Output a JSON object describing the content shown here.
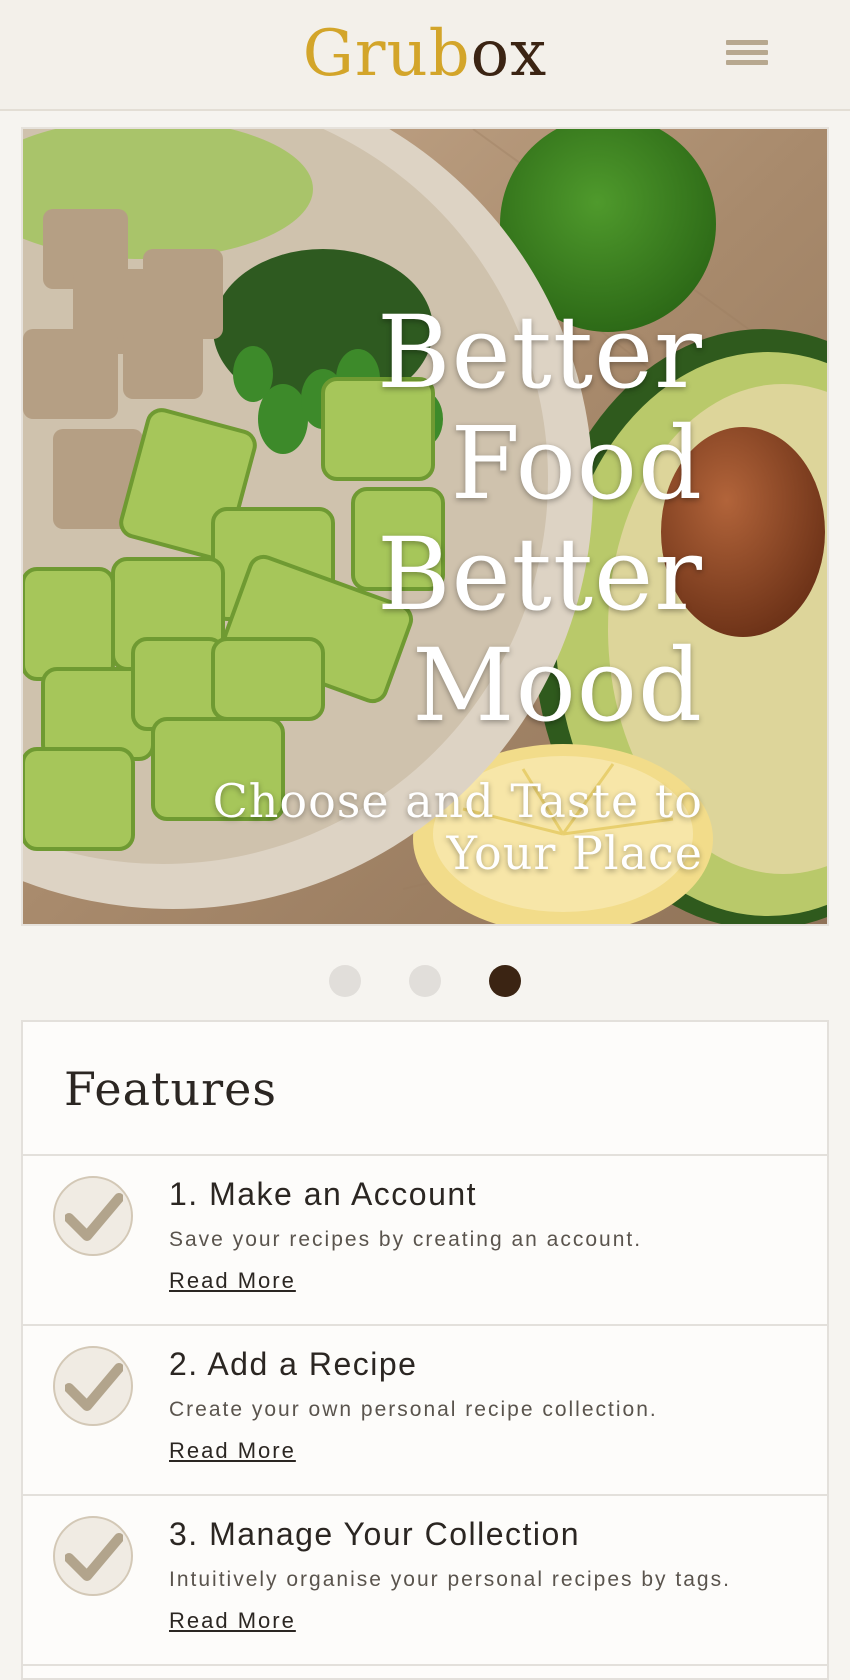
{
  "header": {
    "logo_part1": "Grub",
    "logo_part2": "ox",
    "menu_icon": "hamburger-menu-icon"
  },
  "hero": {
    "headline": [
      "Better",
      "Food",
      "Better",
      "Mood"
    ],
    "subheadline": "Choose and Taste to Your Place",
    "image": "food bowl with avocado, tofu, lime",
    "slides_total": 3,
    "active_slide": 3
  },
  "features": {
    "title": "Features",
    "items": [
      {
        "title": "1. Make an Account",
        "description": "Save your recipes by creating an account.",
        "link": "Read More",
        "icon": "checkmark-icon"
      },
      {
        "title": "2. Add a Recipe",
        "description": "Create your own personal recipe collection.",
        "link": "Read More",
        "icon": "checkmark-icon"
      },
      {
        "title": "3. Manage Your Collection",
        "description": "Intuitively organise your personal recipes by tags.",
        "link": "Read More",
        "icon": "checkmark-icon"
      }
    ]
  },
  "colors": {
    "brand_gold": "#d3a52a",
    "brand_brown": "#3b2413",
    "accent_tan": "#b7a88f",
    "background": "#f6f4f0"
  }
}
